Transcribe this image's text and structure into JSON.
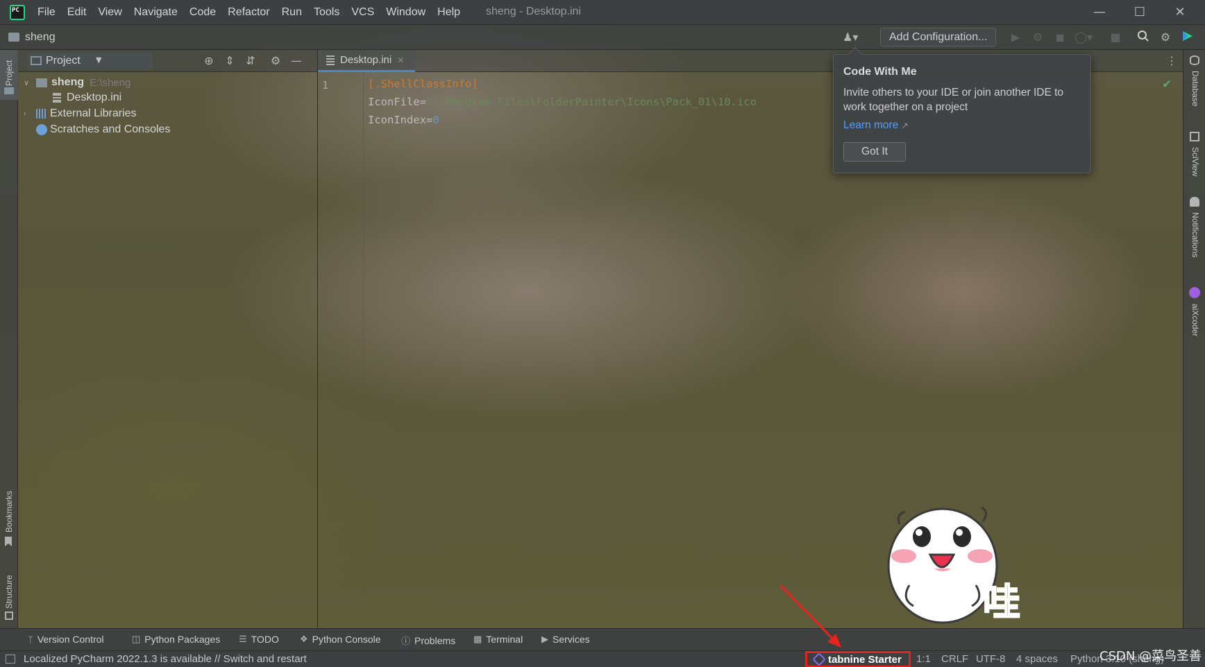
{
  "app": {
    "icon": "pycharm-logo-icon",
    "window_title": "sheng - Desktop.ini",
    "menu": [
      "File",
      "Edit",
      "View",
      "Navigate",
      "Code",
      "Refactor",
      "Run",
      "Tools",
      "VCS",
      "Window",
      "Help"
    ]
  },
  "navbar": {
    "project": "sheng",
    "add_configuration": "Add Configuration..."
  },
  "project_panel": {
    "title": "Project",
    "tree": [
      {
        "label": "sheng",
        "path": "E:\\sheng",
        "expanded": true,
        "icon": "folder-icon"
      },
      {
        "label": "Desktop.ini",
        "icon": "text-file-icon"
      },
      {
        "label": "External Libraries",
        "expanded": false,
        "icon": "libraries-icon"
      },
      {
        "label": "Scratches and Consoles",
        "icon": "scratches-icon"
      }
    ]
  },
  "editor": {
    "tab": {
      "label": "Desktop.ini"
    },
    "line_number": "1",
    "code": {
      "line1": "[.ShellClassInfo]",
      "line2_key": "IconFile=",
      "line2_val": "C:\\Program Files\\FolderPainter\\Icons\\Pack_01\\10.ico",
      "line3_key": "IconIndex=",
      "line3_val": "0"
    }
  },
  "popup": {
    "title": "Code With Me",
    "body": "Invite others to your IDE or join another IDE to work together on a project",
    "link": "Learn more",
    "button": "Got It"
  },
  "left_stripe": {
    "project": "Project",
    "bookmarks": "Bookmarks",
    "structure": "Structure"
  },
  "right_stripe": {
    "database": "Database",
    "sciview": "SciView",
    "notifications": "Notifications",
    "aixcoder": "aiXcoder"
  },
  "tool_windows": [
    {
      "label": "Version Control",
      "icon": "vcs-icon"
    },
    {
      "label": "Python Packages",
      "icon": "packages-icon"
    },
    {
      "label": "TODO",
      "icon": "todo-icon"
    },
    {
      "label": "Python Console",
      "icon": "python-icon"
    },
    {
      "label": "Problems",
      "icon": "problems-icon"
    },
    {
      "label": "Terminal",
      "icon": "terminal-icon"
    },
    {
      "label": "Services",
      "icon": "services-icon"
    }
  ],
  "status_bar": {
    "message": "Localized PyCharm 2022.1.3 is available // Switch and restart",
    "tabnine": "tabnine Starter",
    "position": "1:1",
    "line_sep": "CRLF",
    "encoding": "UTF-8",
    "indent": "4 spaces",
    "interpreter": "Python 3.10 (sheng)"
  },
  "overlay": {
    "sticker_text": "哇",
    "watermark": "CSDN @菜鸟圣善"
  },
  "colors": {
    "keyword": "#cc7832",
    "string": "#6a8759",
    "number": "#6897bb",
    "link": "#589df6",
    "highlight_box": "#e8231f"
  }
}
